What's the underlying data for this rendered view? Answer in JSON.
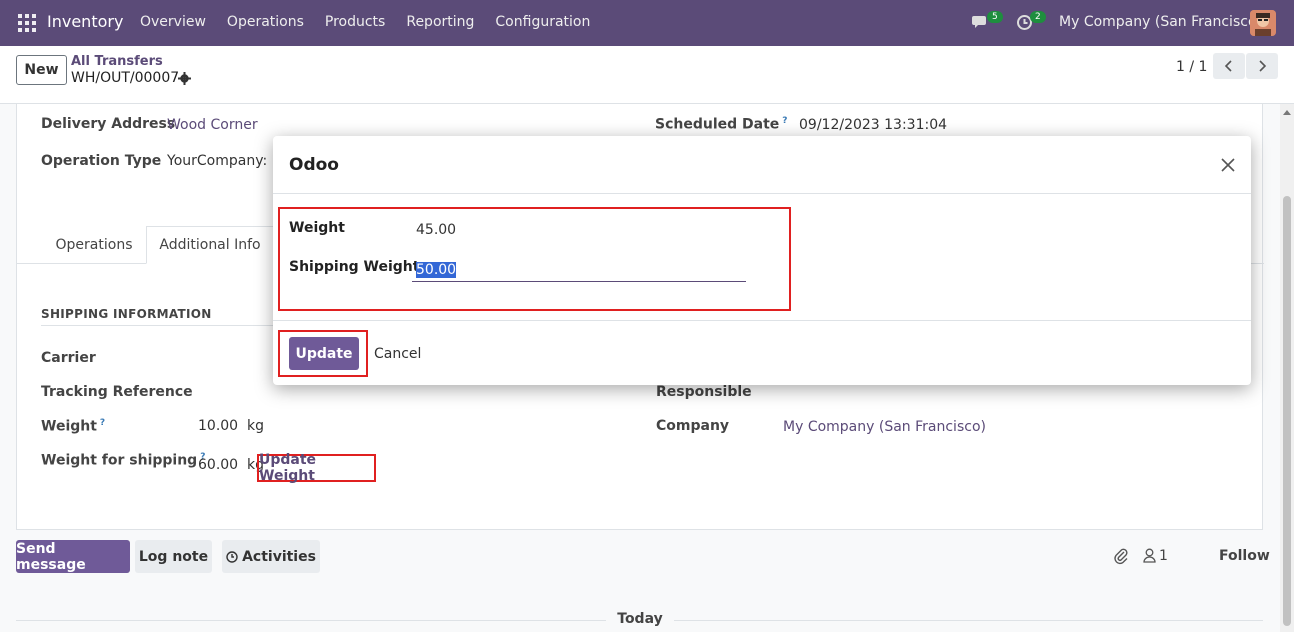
{
  "navbar": {
    "app_name": "Inventory",
    "menu": [
      "Overview",
      "Operations",
      "Products",
      "Reporting",
      "Configuration"
    ],
    "chat_count": "5",
    "activity_count": "2",
    "company": "My Company (San Francisco)"
  },
  "control": {
    "new_label": "New",
    "breadcrumb": "All Transfers",
    "record": "WH/OUT/00007",
    "pager": "1 / 1"
  },
  "form": {
    "delivery_address_label": "Delivery Address",
    "delivery_address_value": "Wood Corner",
    "operation_type_label": "Operation Type",
    "operation_type_value": "YourCompany: D",
    "scheduled_date_label": "Scheduled Date",
    "scheduled_date_value": "09/12/2023 13:31:04",
    "tabs": [
      "Operations",
      "Additional Info"
    ],
    "section_title": "SHIPPING INFORMATION",
    "carrier_label": "Carrier",
    "tracking_label": "Tracking Reference",
    "weight_label": "Weight",
    "weight_value": "10.00",
    "weight_unit": "kg",
    "shipping_weight_label": "Weight for shipping",
    "shipping_weight_value": "60.00",
    "shipping_weight_unit": "kg",
    "update_weight_label": "Update Weight",
    "responsible_label": "Responsible",
    "company_label": "Company",
    "company_value": "My Company (San Francisco)",
    "help_mark": "?"
  },
  "chatter": {
    "send_message": "Send message",
    "log_note": "Log note",
    "activities": "Activities",
    "followers_count": "1",
    "follow": "Follow",
    "today": "Today"
  },
  "modal": {
    "title": "Odoo",
    "weight_label": "Weight",
    "weight_value": "45.00",
    "shipping_weight_label": "Shipping Weight",
    "shipping_weight_value": "50.00",
    "update_label": "Update",
    "cancel_label": "Cancel"
  },
  "colors": {
    "brand": "#5b4b78",
    "primary_button": "#6f5a98",
    "highlight_box": "#e02020",
    "badge": "#1e8e3e"
  }
}
